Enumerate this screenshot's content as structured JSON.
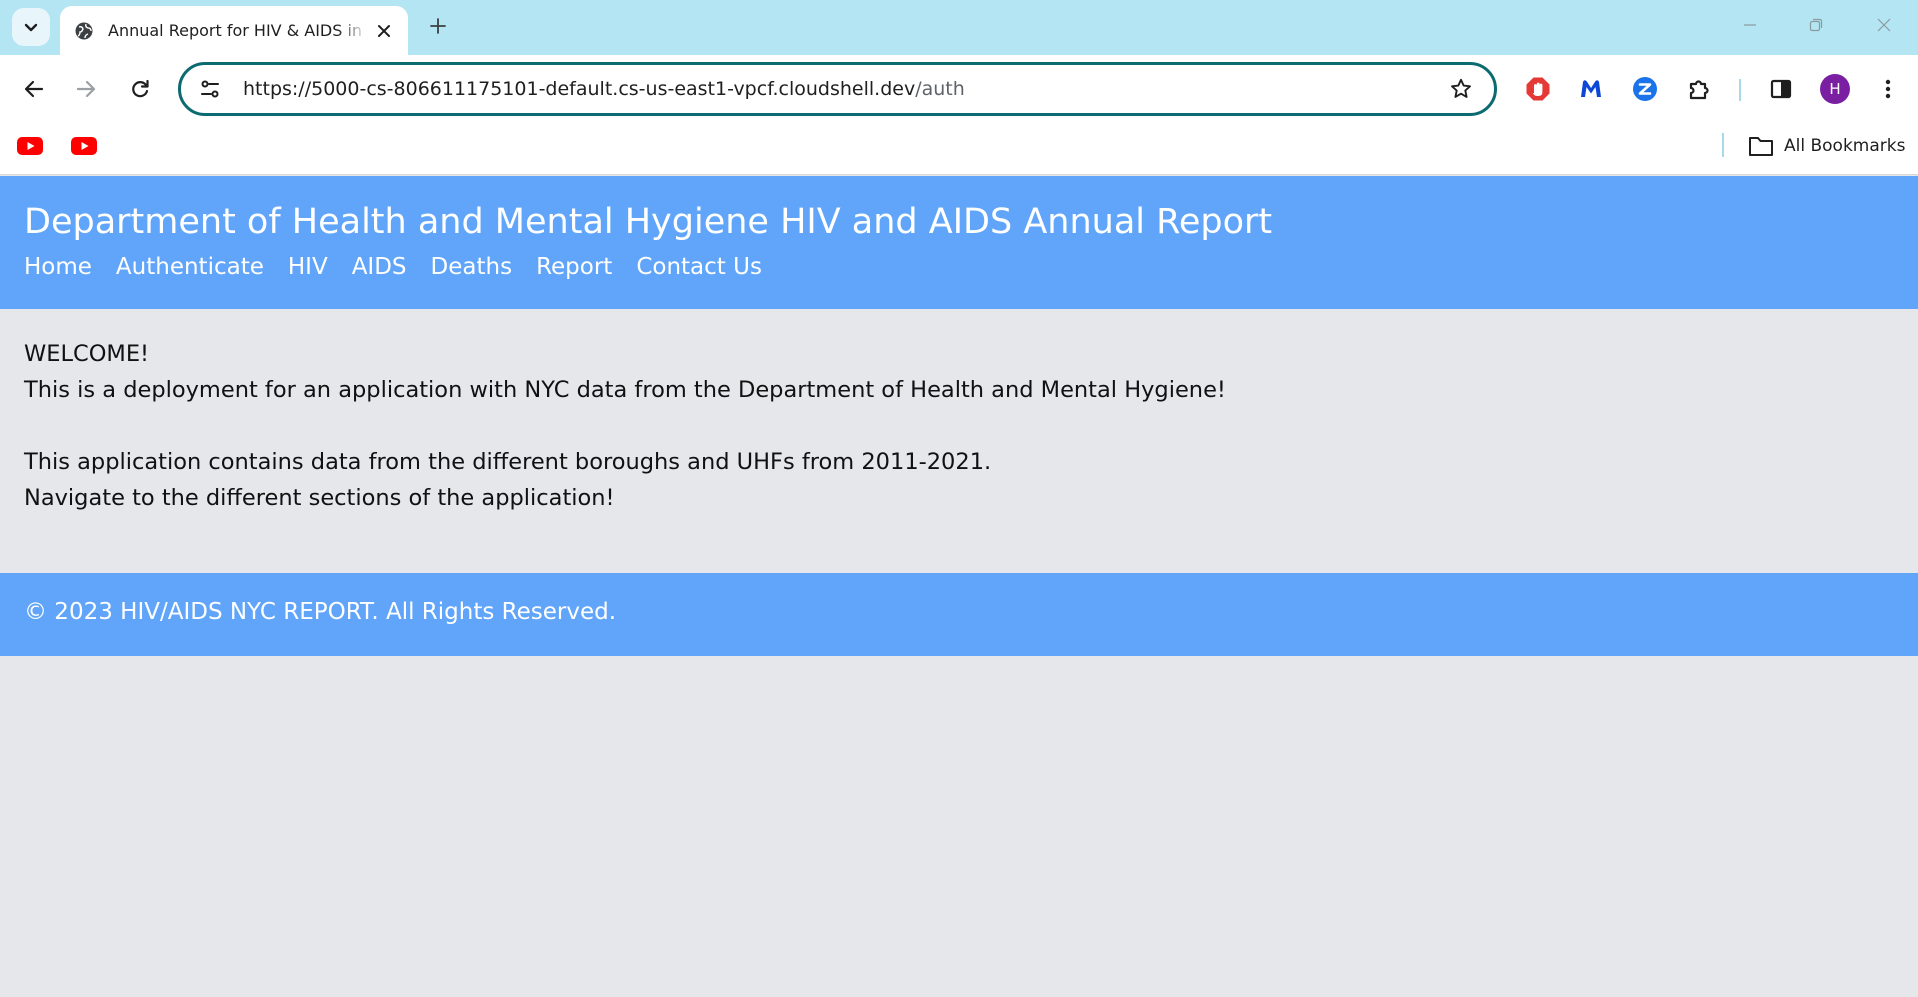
{
  "browser": {
    "tab_title": "Annual Report for HIV & AIDS in NYC",
    "url_host": "https://5000-cs-806611175101-default.cs-us-east1-vpcf.cloudshell.dev",
    "url_path": "/auth",
    "avatar_initial": "H",
    "all_bookmarks_label": "All Bookmarks",
    "extensions": [
      "adblock-icon",
      "malwarebytes-icon",
      "zoom-icon",
      "extensions-puzzle-icon"
    ]
  },
  "site": {
    "title": "Department of Health and Mental Hygiene HIV and AIDS Annual Report",
    "nav": [
      {
        "label": "Home"
      },
      {
        "label": "Authenticate"
      },
      {
        "label": "HIV"
      },
      {
        "label": "AIDS"
      },
      {
        "label": "Deaths"
      },
      {
        "label": "Report"
      },
      {
        "label": "Contact Us"
      }
    ],
    "content": {
      "welcome": "WELCOME!",
      "line1": "This is a deployment for an application with NYC data from the Department of Health and Mental Hygiene!",
      "line2": "This application contains data from the different boroughs and UHFs from 2011-2021.",
      "line3": "Navigate to the different sections of the application!"
    },
    "footer": "© 2023 HIV/AIDS NYC REPORT. All Rights Reserved."
  },
  "colors": {
    "header_bg": "#60a5fa",
    "page_bg": "#e5e7eb",
    "tabstrip_bg": "#b3e5f3",
    "omnibox_border": "#0b6b70"
  }
}
